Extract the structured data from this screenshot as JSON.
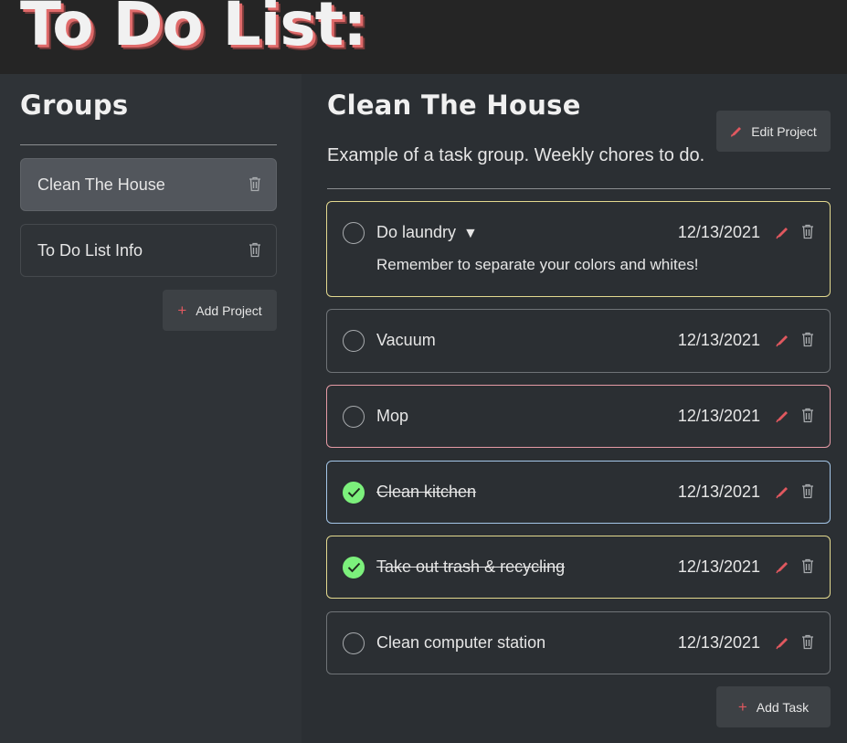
{
  "app": {
    "title": "To Do List:"
  },
  "sidebar": {
    "title": "Groups",
    "projects": [
      {
        "label": "Clean The House",
        "active": true
      },
      {
        "label": "To Do List Info",
        "active": false
      }
    ],
    "add_project": {
      "icon": "plus-icon",
      "label": "Add Project"
    }
  },
  "main": {
    "title": "Clean The House",
    "description": "Example of a task group. Weekly chores to do.",
    "edit_project": {
      "icon": "pencil-icon",
      "label": "Edit Project"
    },
    "tasks": [
      {
        "name": "Do laundry",
        "expanded": true,
        "caret": "▼",
        "note": "Remember to separate your colors and whites!",
        "date": "12/13/2021",
        "done": false,
        "priority_color": "#e3d98f"
      },
      {
        "name": "Vacuum",
        "date": "12/13/2021",
        "done": false,
        "priority_color": "#6f7377"
      },
      {
        "name": "Mop",
        "date": "12/13/2021",
        "done": false,
        "priority_color": "#e59aa5"
      },
      {
        "name": "Clean kitchen",
        "date": "12/13/2021",
        "done": true,
        "priority_color": "#a4c6e8"
      },
      {
        "name": "Take out trash & recycling",
        "date": "12/13/2021",
        "done": true,
        "priority_color": "#e3d98f"
      },
      {
        "name": "Clean computer station",
        "date": "12/13/2021",
        "done": false,
        "priority_color": "#6f7377"
      }
    ],
    "add_task": {
      "icon": "plus-icon",
      "label": "Add Task"
    }
  },
  "colors": {
    "accent": "#e0585f",
    "done": "#7cf07c",
    "background": "#2b2f33",
    "sidebar": "#2f3337",
    "header": "#252525"
  }
}
